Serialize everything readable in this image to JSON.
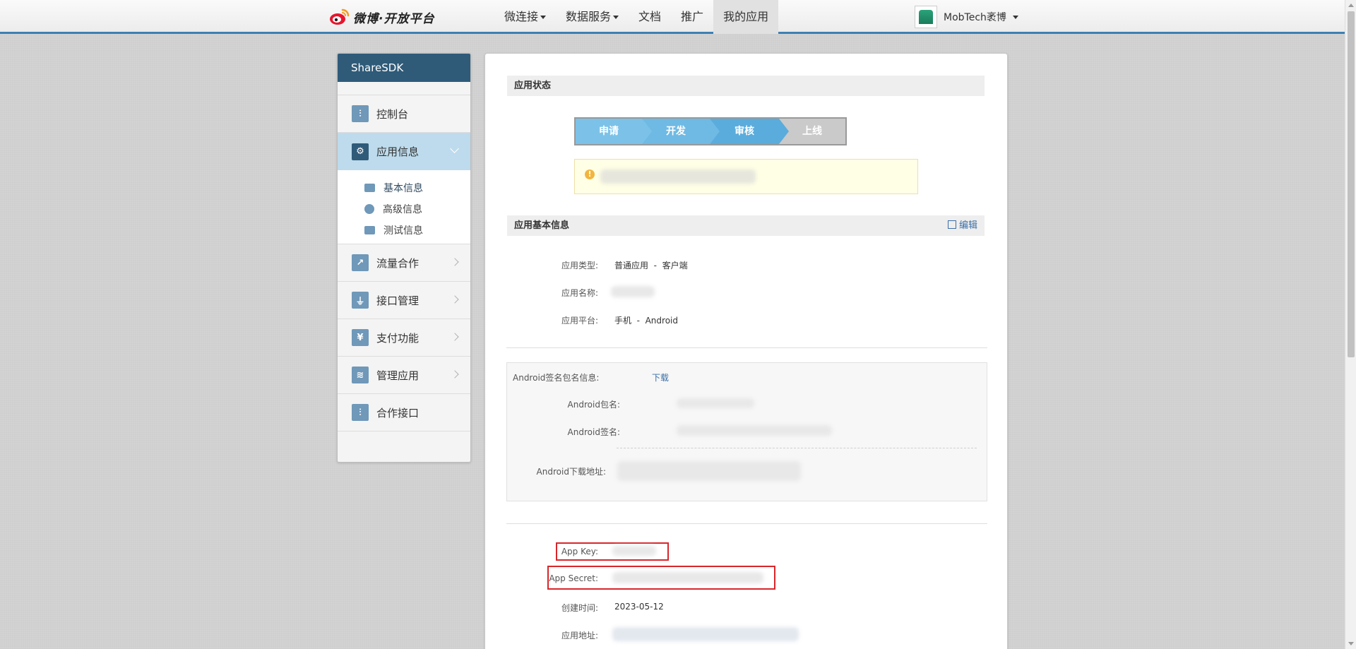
{
  "topbar": {
    "logo_text": "微博·开放平台",
    "nav": [
      {
        "label": "微连接",
        "has_caret": true
      },
      {
        "label": "数据服务",
        "has_caret": true
      },
      {
        "label": "文档",
        "has_caret": false
      },
      {
        "label": "推广",
        "has_caret": false
      },
      {
        "label": "我的应用",
        "has_caret": false,
        "active": true
      }
    ],
    "username": "MobTech袤博"
  },
  "sidebar": {
    "title": "ShareSDK",
    "items": [
      {
        "label": "控制台",
        "icon": "sliders-icon"
      },
      {
        "label": "应用信息",
        "icon": "gear-icon",
        "active": true,
        "expanded": true
      },
      {
        "label": "流量合作",
        "icon": "chart-icon"
      },
      {
        "label": "接口管理",
        "icon": "plug-icon"
      },
      {
        "label": "支付功能",
        "icon": "yen-icon"
      },
      {
        "label": "管理应用",
        "icon": "layers-icon"
      },
      {
        "label": "合作接口",
        "icon": "sliders-icon"
      }
    ],
    "submenu": [
      {
        "label": "基本信息",
        "icon": "id-card-icon",
        "active": true
      },
      {
        "label": "高级信息",
        "icon": "alert-circle-icon"
      },
      {
        "label": "测试信息",
        "icon": "image-icon"
      }
    ]
  },
  "main": {
    "status_title": "应用状态",
    "steps": [
      {
        "label": "申请",
        "state": "done"
      },
      {
        "label": "开发",
        "state": "done"
      },
      {
        "label": "审核",
        "state": "current"
      },
      {
        "label": "上线",
        "state": "todo"
      }
    ],
    "basic_title": "应用基本信息",
    "edit_label": "编辑",
    "app_type_label": "应用类型:",
    "app_type_value": "普通应用  -  客户端",
    "app_name_label": "应用名称:",
    "app_platform_label": "应用平台:",
    "app_platform_value": "手机  -  Android",
    "android_sign_label": "Android签名包名信息:",
    "download_label": "下载",
    "android_package_label": "Android包名:",
    "android_signature_label": "Android签名:",
    "android_download_label": "Android下载地址:",
    "app_key_label": "App Key:",
    "app_secret_label": "App Secret:",
    "created_label": "创建时间:",
    "created_value": "2023-05-12",
    "app_url_label": "应用地址:"
  },
  "colors": {
    "accent": "#3f7fb4",
    "sidebar_head": "#2f5b79",
    "sidebar_active": "#bddbec",
    "highlight_red": "#d9262a"
  }
}
